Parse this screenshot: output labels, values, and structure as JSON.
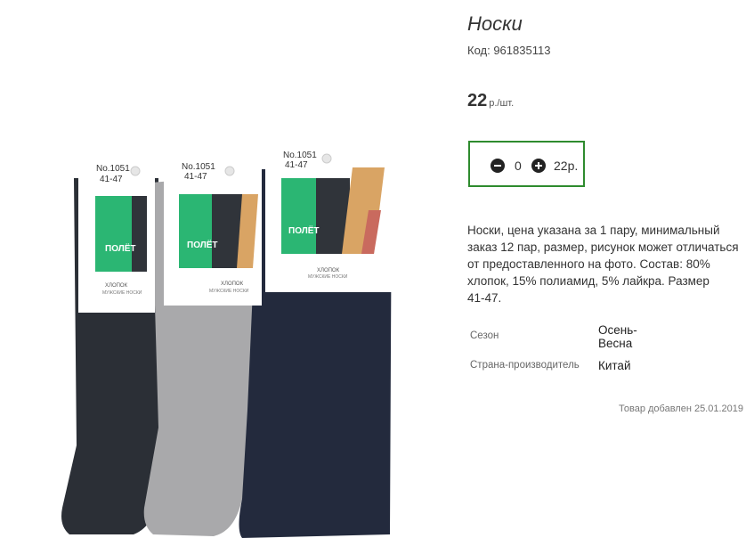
{
  "product": {
    "title": "Носки",
    "code": "Код: 961835113",
    "price_value": "22",
    "price_unit": "р./шт.",
    "quantity": "0",
    "total": "22р.",
    "description_lines": [
      "Носки, цена указана за 1 пару, минимальный",
      "заказ 12 пар, размер, рисунок может отличаться",
      "от предоставленного на фото. Состав: 80%",
      "хлопок, 15% полиамид, 5% лайкра. Размер",
      "41-47."
    ],
    "specs": [
      {
        "label": "Сезон",
        "value_lines": [
          "Осень-",
          "Весна"
        ]
      },
      {
        "label": "Страна-производитель",
        "value_lines": [
          "Китай"
        ]
      }
    ],
    "added": "Товар добавлен 25.01.2019"
  },
  "packaging": {
    "labels": [
      {
        "model": "No.1051",
        "size": "41-47",
        "brand": "ПОЛЁТ",
        "material": "ХЛОПОК",
        "kind": "МУЖСКИЕ НОСКИ"
      },
      {
        "model": "No.1051",
        "size": "41-47",
        "brand": "ПОЛЁТ",
        "material": "ХЛОПОК",
        "kind": "МУЖСКИЕ НОСКИ"
      },
      {
        "model": "No.1051",
        "size": "41-47",
        "brand": "ПОЛЁТ",
        "material": "ХЛОПОК",
        "kind": "МУЖСКИЕ НОСКИ"
      }
    ]
  },
  "colors": {
    "accent_border": "#2e8b2e",
    "sock_dark": "#2b2f36",
    "sock_gray": "#a9a9ab",
    "sock_navy": "#232a3d",
    "label_green": "#2bb673"
  },
  "icons": {
    "minus": "minus-circle-icon",
    "plus": "plus-circle-icon"
  }
}
